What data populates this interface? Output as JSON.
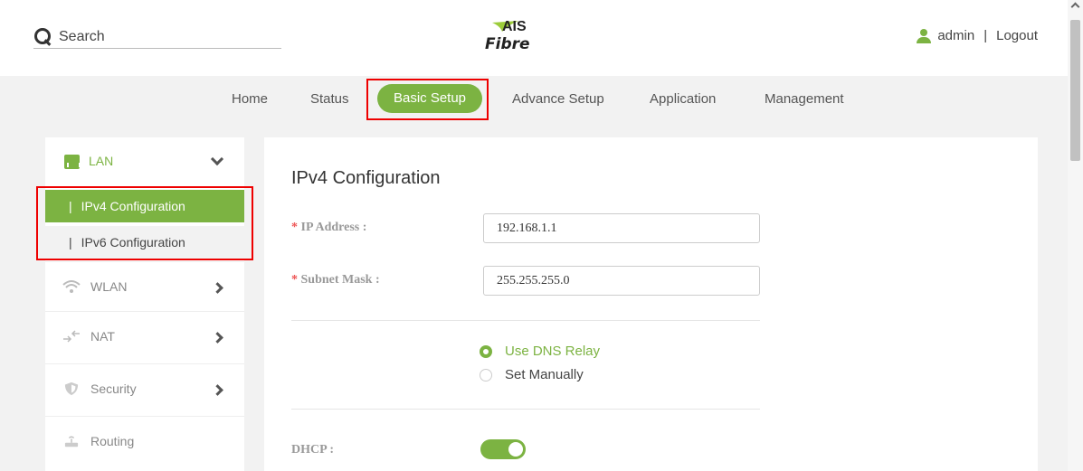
{
  "header": {
    "search_placeholder": "Search",
    "logo_top": "AIS",
    "logo_bottom": "Fibre",
    "user": "admin",
    "separator": "|",
    "logout": "Logout"
  },
  "topnav": {
    "items": [
      "Home",
      "Status",
      "Basic Setup",
      "Advance Setup",
      "Application",
      "Management"
    ],
    "active": "Basic Setup"
  },
  "sidebar": {
    "section": "LAN",
    "sub_bar": "|",
    "subitems": [
      "IPv4 Configuration",
      "IPv6 Configuration"
    ],
    "items": [
      "WLAN",
      "NAT",
      "Security",
      "Routing"
    ]
  },
  "main": {
    "title": "IPv4 Configuration",
    "asterisk": "*",
    "ip_label": "IP Address :",
    "ip_value": "192.168.1.1",
    "mask_label": "Subnet Mask :",
    "mask_value": "255.255.255.0",
    "dns_options": [
      "Use DNS Relay",
      "Set Manually"
    ],
    "dns_selected": "Use DNS Relay",
    "dhcp_label": "DHCP :",
    "dhcp_enabled": true
  },
  "colors": {
    "accent": "#7cb342",
    "highlight": "#ee0000"
  },
  "icons": {
    "search": "search-icon",
    "user": "user-icon",
    "lan": "lan-icon",
    "wlan": "wifi-icon",
    "nat": "nat-arrows-icon",
    "security": "shield-icon",
    "routing": "router-icon"
  }
}
